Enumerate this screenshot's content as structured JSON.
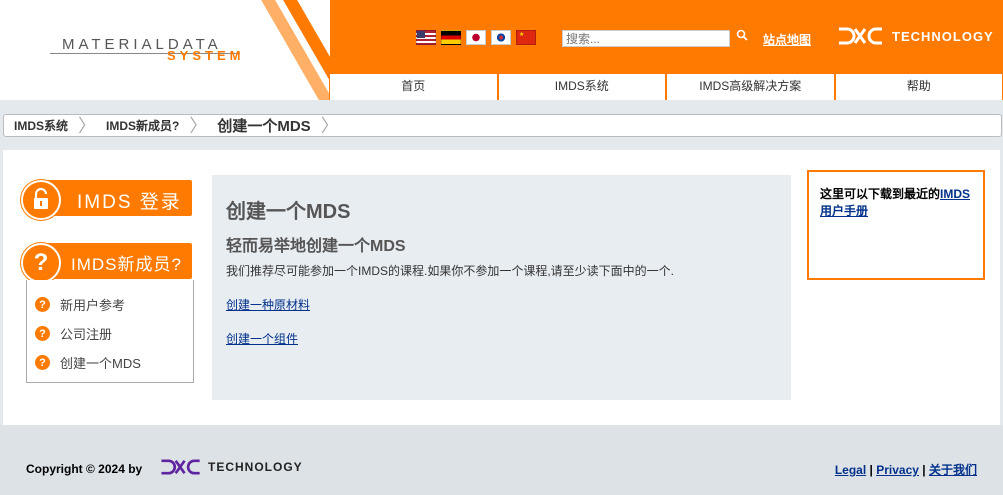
{
  "header": {
    "logo_main": "MATERIALDATA",
    "logo_sub": "SYSTEM",
    "search_placeholder": "搜索...",
    "sitemap_label": "站点地图",
    "brand_text": "TECHNOLOGY",
    "flags": [
      "us-flag",
      "de-flag",
      "jp-flag",
      "kr-flag",
      "cn-flag"
    ]
  },
  "nav": {
    "items": [
      "首页",
      "IMDS系统",
      "IMDS高级解决方案",
      "帮助"
    ]
  },
  "breadcrumb": [
    "IMDS系统",
    "IMDS新成员?",
    "创建一个MDS"
  ],
  "sidebar": {
    "login_label": "IMDS 登录",
    "new_label": "IMDS新成员?",
    "items": [
      "新用户参考",
      "公司注册",
      "创建一个MDS"
    ]
  },
  "main": {
    "title": "创建一个MDS",
    "subtitle": "轻而易举地创建一个MDS",
    "intro": "我们推荐尽可能参加一个IMDS的课程.如果你不参加一个课程,请至少读下面中的一个.",
    "link1": "创建一种原材料",
    "link2": "创建一个组件"
  },
  "sidebox": {
    "text": "这里可以下载到最近的",
    "link": "IMDS 用户手册"
  },
  "footer": {
    "copyright": "Copyright © 2024 by",
    "brand_text": "TECHNOLOGY",
    "links": [
      "Legal",
      "Privacy",
      "关于我们"
    ],
    "sep": "|"
  },
  "colors": {
    "accent": "#ff7a00",
    "link": "#00308a",
    "footer_bg": "#dde2e7",
    "dxc_purple": "#5f249f"
  }
}
